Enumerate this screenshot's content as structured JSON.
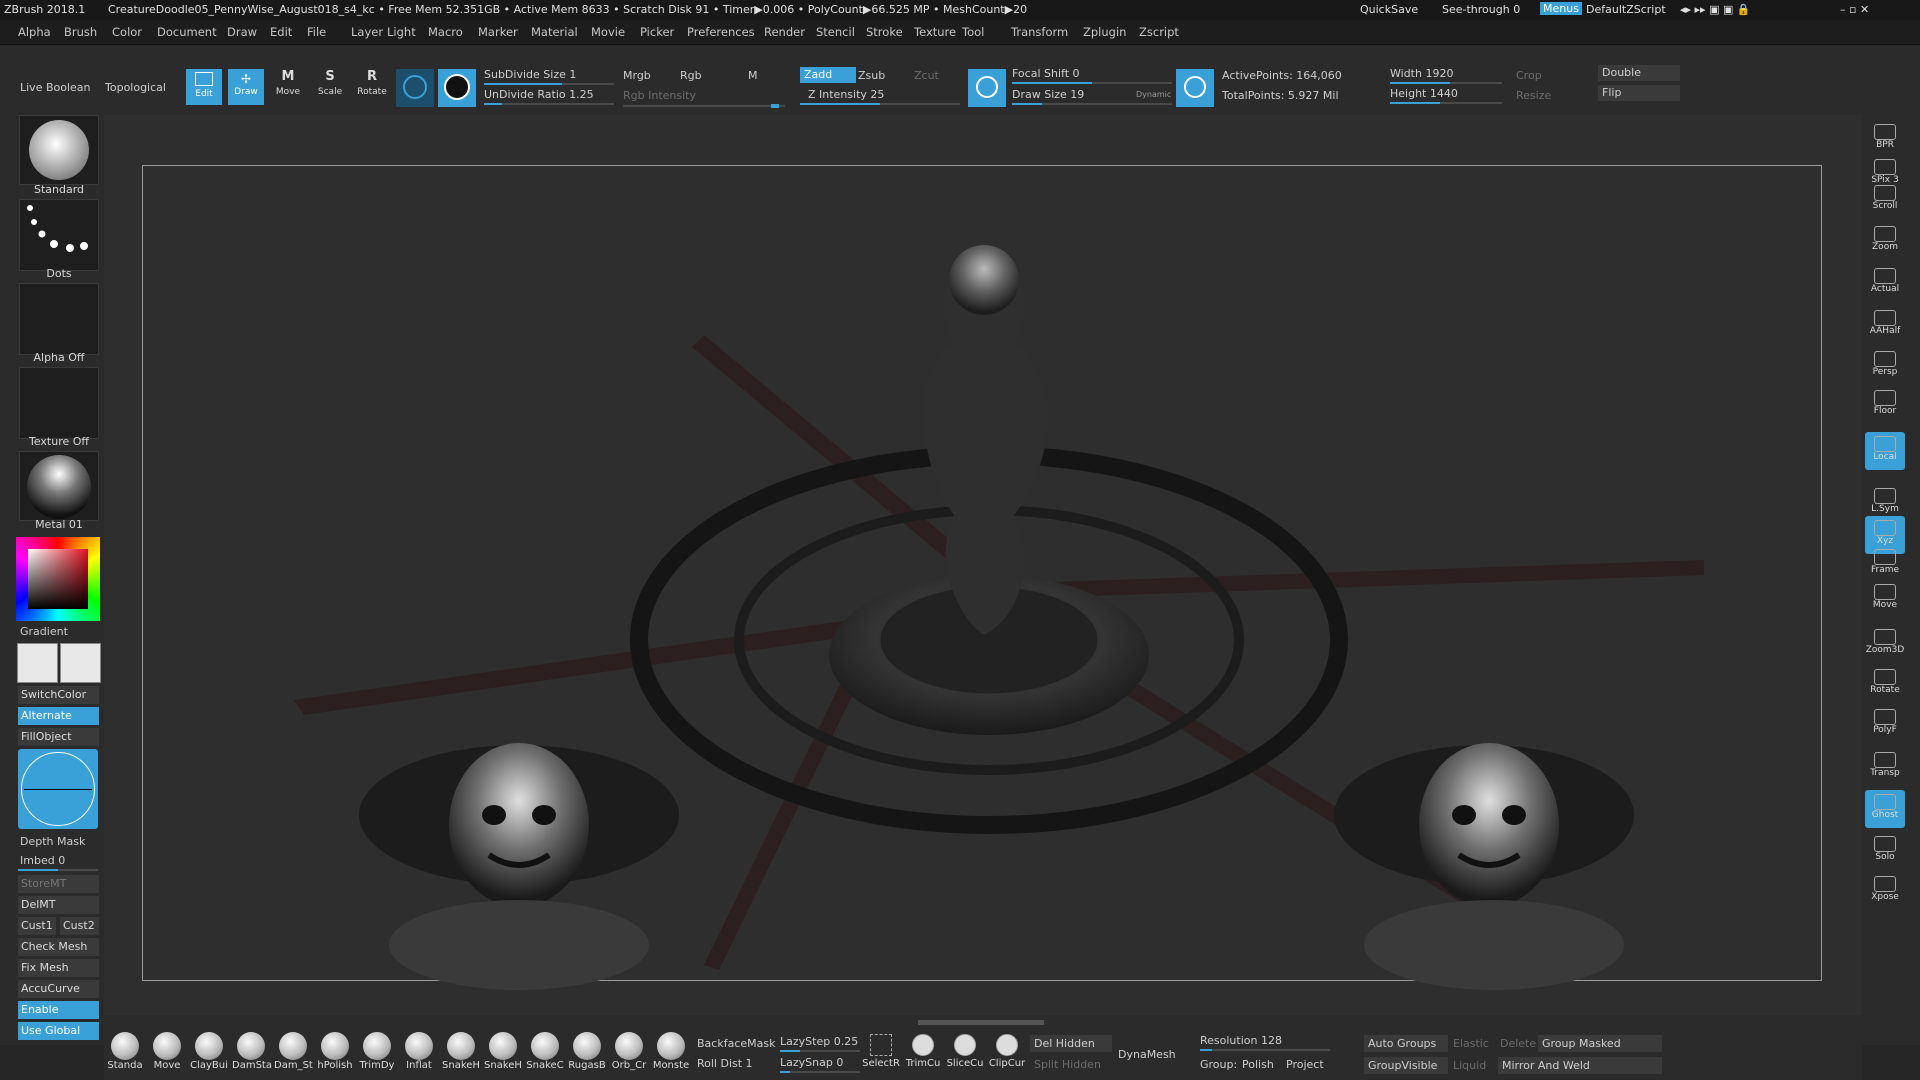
{
  "titlebar": {
    "app": "ZBrush 2018.1",
    "status": "CreatureDoodle05_PennyWise_August018_s4_kc  • Free Mem 52.351GB • Active Mem 8633 • Scratch Disk 91 • Timer▶0.006 • PolyCount▶66.525 MP • MeshCount▶20",
    "quicksave": "QuickSave",
    "seethrough": "See-through  0",
    "menus": "Menus",
    "script": "DefaultZScript"
  },
  "menu": [
    "Alpha",
    "Brush",
    "Color",
    "Document",
    "Draw",
    "Edit",
    "File",
    "Layer",
    "Light",
    "Macro",
    "Marker",
    "Material",
    "Movie",
    "Picker",
    "Preferences",
    "Render",
    "Stencil",
    "Stroke",
    "Texture",
    "Tool",
    "Transform",
    "Zplugin",
    "Zscript"
  ],
  "toolbar": {
    "live_boolean": "Live Boolean",
    "topological": "Topological",
    "edit": "Edit",
    "draw": "Draw",
    "move": "Move",
    "scale": "Scale",
    "rotate": "Rotate",
    "subdivide": "SubDivide Size 1",
    "undivide": "UnDivide Ratio 1.25",
    "mrgb": "Mrgb",
    "rgb": "Rgb",
    "m": "M",
    "rgb_intensity": "Rgb Intensity",
    "zadd": "Zadd",
    "zsub": "Zsub",
    "zcut": "Zcut",
    "z_intensity": "Z Intensity 25",
    "focal_shift": "Focal Shift 0",
    "draw_size": "Draw Size 19",
    "dynamic": "Dynamic",
    "active_points": "ActivePoints: 164,060",
    "total_points": "TotalPoints: 5.927 Mil",
    "width": "Width 1920",
    "height": "Height 1440",
    "crop": "Crop",
    "resize": "Resize",
    "double": "Double",
    "flip": "Flip"
  },
  "left": {
    "brush": "Standard",
    "stroke": "Dots",
    "alpha": "Alpha Off",
    "texture": "Texture Off",
    "material": "Metal 01",
    "gradient": "Gradient",
    "switchcolor": "SwitchColor",
    "alternate": "Alternate",
    "fillobject": "FillObject",
    "depth_mask": "Depth Mask",
    "imbed": "Imbed 0",
    "storemt": "StoreMT",
    "delmt": "DelMT",
    "cust1": "Cust1",
    "cust2": "Cust2",
    "check_mesh": "Check Mesh In",
    "fix_mesh": "Fix Mesh",
    "accucurve": "AccuCurve",
    "enable": "Enable",
    "use_global": "Use Global"
  },
  "right": [
    "BPR",
    "SPix 3",
    "Scroll",
    "Zoom",
    "Actual",
    "AAHalf",
    "Persp",
    "Floor",
    "Local",
    "L.Sym",
    "Xyz",
    "Frame",
    "Move",
    "Zoom3D",
    "Rotate",
    "PolyF",
    "Transp",
    "Ghost",
    "Solo",
    "Xpose"
  ],
  "bottom": {
    "brushes": [
      "Standa",
      "Move",
      "ClayBui",
      "DamSta",
      "Dam_St",
      "hPolish",
      "TrimDy",
      "Inflat",
      "SnakeH",
      "SnakeH",
      "SnakeC",
      "RugasB",
      "Orb_Cr",
      "Monste"
    ],
    "backface": "BackfaceMask",
    "lazystep": "LazyStep 0.25",
    "rolldist": "Roll Dist 1",
    "lazysnap": "LazySnap 0",
    "tools": [
      "SelectR",
      "TrimCu",
      "SliceCu",
      "ClipCur"
    ],
    "del_hidden": "Del Hidden",
    "split_hidden": "Split Hidden",
    "dynamesh": "DynaMesh",
    "resolution": "Resolution 128",
    "group": "Group:",
    "polish": "Polish",
    "project": "Project",
    "auto_groups": "Auto Groups",
    "elastic": "Elastic",
    "delete": "Delete",
    "group_masked": "Group Masked",
    "group_visible": "GroupVisible",
    "liquid": "Liquid",
    "mirror_weld": "Mirror And Weld"
  },
  "colors": {
    "accent": "#3aa0d8"
  }
}
